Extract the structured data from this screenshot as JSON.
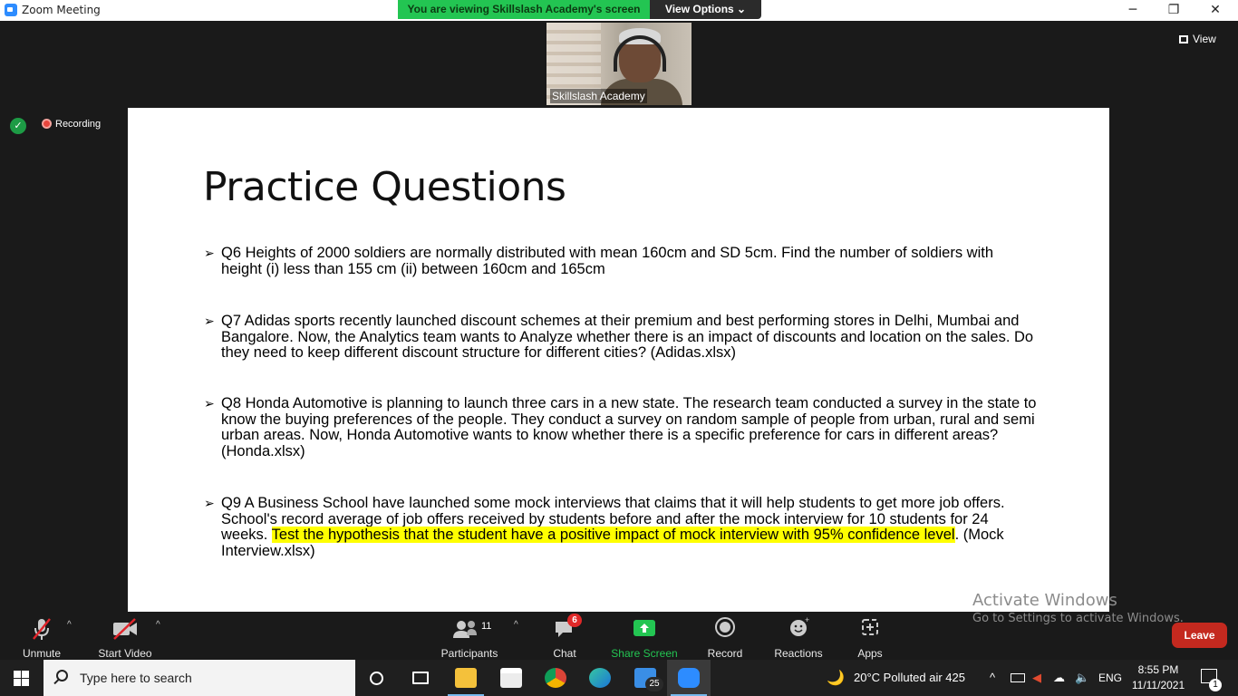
{
  "window": {
    "title": "Zoom Meeting",
    "minimize": "─",
    "restore": "❐",
    "close": "✕"
  },
  "share_banner": {
    "text": "You are viewing Skillslash Academy's screen",
    "view_options": "View Options ⌄"
  },
  "video": {
    "participant_name": "Skillslash Academy"
  },
  "view_button": {
    "label": "View"
  },
  "recording": {
    "label": "Recording"
  },
  "slide": {
    "title": "Practice Questions",
    "bullet": "➢",
    "questions": [
      {
        "text": "Q6 Heights of 2000 soldiers are normally distributed with mean 160cm and SD 5cm. Find the number of soldiers with height (i) less than 155 cm (ii) between 160cm and 165cm"
      },
      {
        "text": "Q7 Adidas sports recently launched discount schemes at their premium  and best performing stores in Delhi, Mumbai and Bangalore. Now, the Analytics team wants to Analyze whether there is an impact of discounts and location on the sales. Do they need to keep different discount structure for different cities? (Adidas.xlsx)"
      },
      {
        "text": "Q8 Honda Automotive is planning to launch three cars in a new state. The research team conducted a survey in the state to know the buying preferences of the people. They conduct a survey on random sample of people from urban, rural and semi urban areas. Now, Honda Automotive wants to know whether there is a specific preference for cars in different areas? (Honda.xlsx)"
      },
      {
        "text_before": "Q9 A Business School have launched some mock interviews that claims that it will help students to get more job offers. School's  record average of job offers received by students before and after the mock interview for 10 students for 24 weeks. ",
        "text_highlight": "Test the hypothesis that the student have a positive impact of mock interview with 95% confidence level",
        "text_after": ". (Mock Interview.xlsx)"
      }
    ],
    "highlight_color": "#ffff00"
  },
  "activate_windows": {
    "line1": "Activate Windows",
    "line2": "Go to Settings to activate Windows."
  },
  "toolbar": {
    "unmute": "Unmute",
    "start_video": "Start Video",
    "participants": "Participants",
    "participants_count": "11",
    "chat": "Chat",
    "chat_badge": "6",
    "share_screen": "Share Screen",
    "record": "Record",
    "reactions": "Reactions",
    "apps": "Apps",
    "leave": "Leave",
    "caret": "^"
  },
  "taskbar": {
    "search_placeholder": "Type here to search",
    "mail_badge": "25",
    "weather": "20°C  Polluted air 425",
    "language": "ENG",
    "time": "8:55 PM",
    "date": "11/11/2021",
    "notification_count": "1"
  },
  "colors": {
    "share_green": "#23c552",
    "leave_red": "#c4291f",
    "zoom_blue": "#2d8cff"
  }
}
